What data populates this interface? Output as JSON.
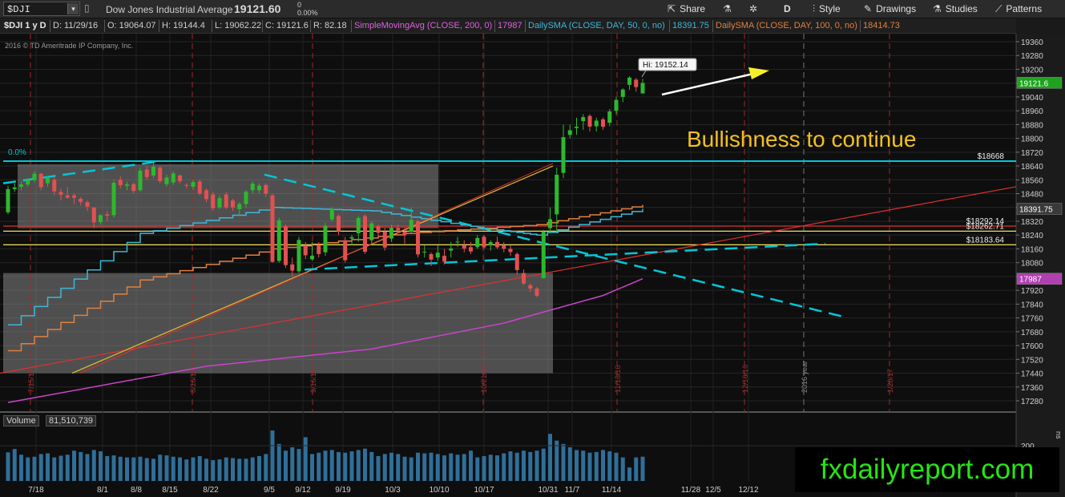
{
  "toolbar": {
    "symbol": "$DJI",
    "instrument_name": "Dow Jones Industrial Average",
    "last_price": "19121.60",
    "change": "0",
    "change_pct": "0.00%",
    "share_label": "Share",
    "aggregation_label": "D",
    "style_label": "Style",
    "drawings_label": "Drawings",
    "studies_label": "Studies",
    "patterns_label": "Patterns"
  },
  "infobar": {
    "title": "$DJI 1 y D",
    "date": "D: 11/29/16",
    "open": "O: 19064.07",
    "high": "H: 19144.4",
    "low": "L: 19062.22",
    "close": "C: 19121.6",
    "range": "R: 82.18",
    "sma200_label": "SimpleMovingAvg (CLOSE, 200, 0)",
    "sma200_value": "17987",
    "sma50_label": "DailySMA (CLOSE, DAY, 50, 0, no)",
    "sma50_value": "18391.75",
    "sma100_label": "DailySMA (CLOSE, DAY, 100, 0, no)",
    "sma100_value": "18414.73"
  },
  "copyright": "2016 © TD Ameritrade IP Company, Inc.",
  "annotation": "Bullishness to continue",
  "watermark": "fxdailyreport.com",
  "volume_pane": {
    "label": "Volume",
    "value": "81,510,739",
    "scale_label": "200",
    "units_label": "ns"
  },
  "colors": {
    "up": "#2eb82e",
    "down": "#e35050",
    "fib": "#00c8d8",
    "sma200": "#cc44cc",
    "sma50": "#3db8d8",
    "sma100": "#e08040",
    "trend": "#e03030",
    "support": "#f0e060",
    "annotation": "#f2c01f",
    "watermark": "#26e614"
  },
  "chart_data": {
    "type": "candlestick",
    "title": "$DJI 1 y D",
    "ylim": [
      17200,
      19440
    ],
    "y_ticks": [
      17280,
      17360,
      17440,
      17520,
      17600,
      17680,
      17760,
      17840,
      17920,
      18000,
      18080,
      18160,
      18240,
      18320,
      18400,
      18480,
      18560,
      18640,
      18720,
      18800,
      18880,
      18960,
      19040,
      19120,
      19200,
      19280,
      19360
    ],
    "x_ticks": [
      "7/18",
      "8/1",
      "8/8",
      "8/15",
      "8/22",
      "9/5",
      "9/12",
      "9/19",
      "10/3",
      "10/10",
      "10/17",
      "10/31",
      "11/7",
      "11/14",
      "11/28",
      "12/5",
      "12/12"
    ],
    "x_markers": [
      {
        "label": "7/15/16",
        "style": "red-dashed"
      },
      {
        "label": "8/16/16",
        "style": "red-dashed"
      },
      {
        "label": "9/16/16",
        "style": "red-dashed"
      },
      {
        "label": "10/21/16",
        "style": "red-dashed"
      },
      {
        "label": "11/18/16",
        "style": "red-dashed"
      },
      {
        "label": "12/16/16",
        "style": "red-dashed"
      },
      {
        "label": "2016 year",
        "style": "gray-dashed"
      },
      {
        "label": "1/20/17",
        "style": "red-dashed"
      }
    ],
    "last_price": 19121.6,
    "high_label": "Hi: 19152.14",
    "high_value": 19152.14,
    "price_bubbles": [
      {
        "value": 19121.6,
        "label": "19121.6",
        "color": "#1fa31f"
      },
      {
        "value": 18391.75,
        "label": "18391.75",
        "color": "#3a3a3a"
      },
      {
        "value": 17987,
        "label": "17987",
        "color": "#b040b0"
      }
    ],
    "levels": [
      {
        "value": 18668,
        "label": "$18668",
        "pct_label": "0.0%",
        "color": "#00c8d8"
      },
      {
        "value": 18292.14,
        "label": "$18292.14",
        "color": "#e03030"
      },
      {
        "value": 18262.71,
        "label": "$18262.71",
        "color": "#f0e060"
      },
      {
        "value": 18183.64,
        "label": "$18183.64",
        "color": "#f0e060"
      }
    ],
    "candles": {
      "description": "Daily OHLC from mid-July to 11/29/16 (approximate)",
      "dates": [
        "7/14",
        "7/15",
        "7/18",
        "7/19",
        "7/20",
        "7/21",
        "7/22",
        "7/25",
        "7/26",
        "7/27",
        "7/28",
        "7/29",
        "8/1",
        "8/2",
        "8/3",
        "8/4",
        "8/5",
        "8/8",
        "8/9",
        "8/10",
        "8/11",
        "8/12",
        "8/15",
        "8/16",
        "8/17",
        "8/18",
        "8/19",
        "8/22",
        "8/23",
        "8/24",
        "8/25",
        "8/26",
        "8/29",
        "8/30",
        "8/31",
        "9/1",
        "9/2",
        "9/6",
        "9/7",
        "9/8",
        "9/9",
        "9/12",
        "9/13",
        "9/14",
        "9/15",
        "9/16",
        "9/19",
        "9/20",
        "9/21",
        "9/22",
        "9/23",
        "9/26",
        "9/27",
        "9/28",
        "9/29",
        "9/30",
        "10/3",
        "10/4",
        "10/5",
        "10/6",
        "10/7",
        "10/10",
        "10/11",
        "10/12",
        "10/13",
        "10/14",
        "10/17",
        "10/18",
        "10/19",
        "10/20",
        "10/21",
        "10/24",
        "10/25",
        "10/26",
        "10/27",
        "10/28",
        "10/31",
        "11/1",
        "11/2",
        "11/3",
        "11/4",
        "11/7",
        "11/8",
        "11/9",
        "11/10",
        "11/11",
        "11/14",
        "11/15",
        "11/16",
        "11/17",
        "11/18",
        "11/21",
        "11/22",
        "11/23",
        "11/25",
        "11/28",
        "11/29"
      ],
      "open": [
        18372,
        18506,
        18520,
        18533,
        18560,
        18595,
        18540,
        18560,
        18490,
        18470,
        18470,
        18450,
        18430,
        18400,
        18315,
        18360,
        18355,
        18560,
        18525,
        18535,
        18500,
        18620,
        18585,
        18630,
        18535,
        18545,
        18585,
        18530,
        18520,
        18550,
        18500,
        18475,
        18400,
        18475,
        18440,
        18390,
        18420,
        18500,
        18500,
        18530,
        18470,
        18090,
        18290,
        18070,
        18030,
        18180,
        18100,
        18180,
        18140,
        18330,
        18350,
        18210,
        18220,
        18250,
        18350,
        18210,
        18290,
        18260,
        18220,
        18280,
        18260,
        18260,
        18320,
        18140,
        18130,
        18110,
        18120,
        18150,
        18200,
        18180,
        18170,
        18170,
        18230,
        18180,
        18200,
        18180,
        18160,
        18130,
        18020,
        17950,
        17930,
        17990,
        18280,
        18360,
        18600,
        18820,
        18860,
        18900,
        18930,
        18870,
        18910,
        18890,
        18960,
        19040,
        19110,
        19140,
        19060
      ],
      "close": [
        18506,
        18516,
        18533,
        18559,
        18595,
        18517,
        18570,
        18493,
        18473,
        18456,
        18456,
        18432,
        18404,
        18313,
        18355,
        18352,
        18543,
        18529,
        18533,
        18495,
        18613,
        18576,
        18636,
        18552,
        18573,
        18597,
        18552,
        18529,
        18547,
        18481,
        18448,
        18395,
        18454,
        18400,
        18400,
        18420,
        18491,
        18538,
        18526,
        18479,
        18085,
        18325,
        18066,
        18034,
        18212,
        18123,
        18120,
        18130,
        18293,
        18392,
        18261,
        18094,
        18228,
        18339,
        18143,
        18308,
        18253,
        18168,
        18281,
        18268,
        18240,
        18329,
        18128,
        18144,
        18098,
        18138,
        18086,
        18162,
        18202,
        18162,
        18145,
        18223,
        18169,
        18199,
        18169,
        18161,
        18142,
        18037,
        17959,
        17930,
        17888,
        18259,
        18332,
        18589,
        18807,
        18847,
        18868,
        18923,
        18868,
        18903,
        18867,
        18956,
        19023,
        19083,
        19152,
        19097,
        19121
      ],
      "high": [
        18525,
        18540,
        18550,
        18570,
        18610,
        18600,
        18580,
        18580,
        18510,
        18520,
        18480,
        18460,
        18440,
        18400,
        18360,
        18380,
        18560,
        18580,
        18550,
        18545,
        18630,
        18640,
        18665,
        18640,
        18590,
        18610,
        18590,
        18540,
        18560,
        18560,
        18510,
        18490,
        18470,
        18490,
        18450,
        18430,
        18500,
        18550,
        18540,
        18540,
        18480,
        18340,
        18300,
        18110,
        18230,
        18200,
        18200,
        18200,
        18310,
        18400,
        18360,
        18230,
        18240,
        18350,
        18360,
        18320,
        18300,
        18280,
        18300,
        18300,
        18280,
        18400,
        18330,
        18180,
        18140,
        18180,
        18160,
        18200,
        18230,
        18210,
        18200,
        18240,
        18240,
        18210,
        18230,
        18200,
        18180,
        18140,
        18040,
        17960,
        17940,
        18270,
        18400,
        18630,
        18880,
        18880,
        18920,
        18940,
        18940,
        18920,
        18920,
        18970,
        19040,
        19090,
        19160,
        19150,
        19145
      ],
      "low": [
        18360,
        18490,
        18500,
        18520,
        18545,
        18500,
        18520,
        18470,
        18440,
        18450,
        18420,
        18410,
        18380,
        18280,
        18300,
        18320,
        18340,
        18510,
        18500,
        18480,
        18490,
        18560,
        18570,
        18540,
        18520,
        18530,
        18540,
        18510,
        18500,
        18470,
        18430,
        18380,
        18390,
        18390,
        18380,
        18350,
        18400,
        18480,
        18480,
        18460,
        18080,
        18080,
        18050,
        18000,
        18020,
        18100,
        18090,
        18110,
        18120,
        18320,
        18240,
        18080,
        18180,
        18200,
        18130,
        18180,
        18230,
        18150,
        18200,
        18250,
        18190,
        18250,
        18110,
        18110,
        18060,
        18090,
        18070,
        18110,
        18170,
        18140,
        18130,
        18160,
        18160,
        18150,
        18160,
        18140,
        18120,
        18010,
        17950,
        17910,
        17880,
        17990,
        18250,
        18250,
        18570,
        18800,
        18820,
        18850,
        18840,
        18840,
        18850,
        18870,
        18940,
        19010,
        19080,
        19070,
        19062
      ]
    },
    "volume": [
      85,
      95,
      78,
      70,
      72,
      80,
      82,
      70,
      75,
      78,
      90,
      86,
      80,
      92,
      88,
      74,
      76,
      72,
      70,
      70,
      72,
      68,
      66,
      78,
      76,
      72,
      70,
      64,
      70,
      74,
      66,
      62,
      64,
      70,
      68,
      66,
      66,
      70,
      74,
      80,
      150,
      110,
      90,
      100,
      95,
      130,
      80,
      84,
      90,
      92,
      86,
      84,
      88,
      92,
      96,
      86,
      74,
      80,
      84,
      80,
      72,
      70,
      84,
      82,
      84,
      80,
      76,
      82,
      78,
      80,
      90,
      70,
      74,
      78,
      76,
      82,
      88,
      84,
      90,
      86,
      90,
      96,
      140,
      120,
      110,
      100,
      92,
      90,
      84,
      86,
      92,
      88,
      84,
      70,
      40,
      70,
      72
    ],
    "overlays": [
      {
        "name": "SimpleMovingAvg (CLOSE, 200, 0)",
        "color": "#cc44cc",
        "points": [
          [
            0,
            17270
          ],
          [
            30,
            17480
          ],
          [
            55,
            17580
          ],
          [
            75,
            17730
          ],
          [
            90,
            17890
          ],
          [
            96,
            17987
          ]
        ]
      },
      {
        "name": "DailySMA (CLOSE, DAY, 50, 0, no)",
        "color": "#3db8d8",
        "style": "step",
        "points": [
          [
            0,
            17720
          ],
          [
            20,
            18250
          ],
          [
            40,
            18400
          ],
          [
            55,
            18380
          ],
          [
            70,
            18290
          ],
          [
            80,
            18240
          ],
          [
            96,
            18391.75
          ]
        ]
      },
      {
        "name": "DailySMA (CLOSE, DAY, 100, 0, no)",
        "color": "#e08040",
        "style": "step",
        "points": [
          [
            0,
            17570
          ],
          [
            20,
            17980
          ],
          [
            40,
            18160
          ],
          [
            60,
            18250
          ],
          [
            80,
            18300
          ],
          [
            96,
            18414.73
          ]
        ]
      }
    ]
  }
}
